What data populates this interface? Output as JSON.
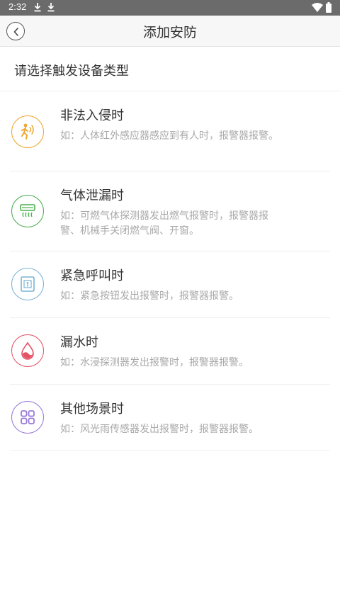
{
  "status_bar": {
    "time": "2:32"
  },
  "header": {
    "title": "添加安防"
  },
  "section_title": "请选择触发设备类型",
  "colors": {
    "orange": "#f0a630",
    "green": "#4caf50",
    "blue": "#7ab4d6",
    "red": "#e45266",
    "purple": "#9a7ad8"
  },
  "items": [
    {
      "title": "非法入侵时",
      "desc": "如：人体红外感应器感应到有人时，报警器报警。",
      "icon": "intrusion-icon"
    },
    {
      "title": "气体泄漏时",
      "desc": "如：可燃气体探测器发出燃气报警时，报警器报警、机械手关闭燃气阀、开窗。",
      "icon": "gas-leak-icon"
    },
    {
      "title": "紧急呼叫时",
      "desc": "如：紧急按钮发出报警时，报警器报警。",
      "icon": "emergency-button-icon"
    },
    {
      "title": "漏水时",
      "desc": "如：水浸探测器发出报警时，报警器报警。",
      "icon": "water-leak-icon"
    },
    {
      "title": "其他场景时",
      "desc": "如：风光雨传感器发出报警时，报警器报警。",
      "icon": "grid-icon"
    }
  ]
}
